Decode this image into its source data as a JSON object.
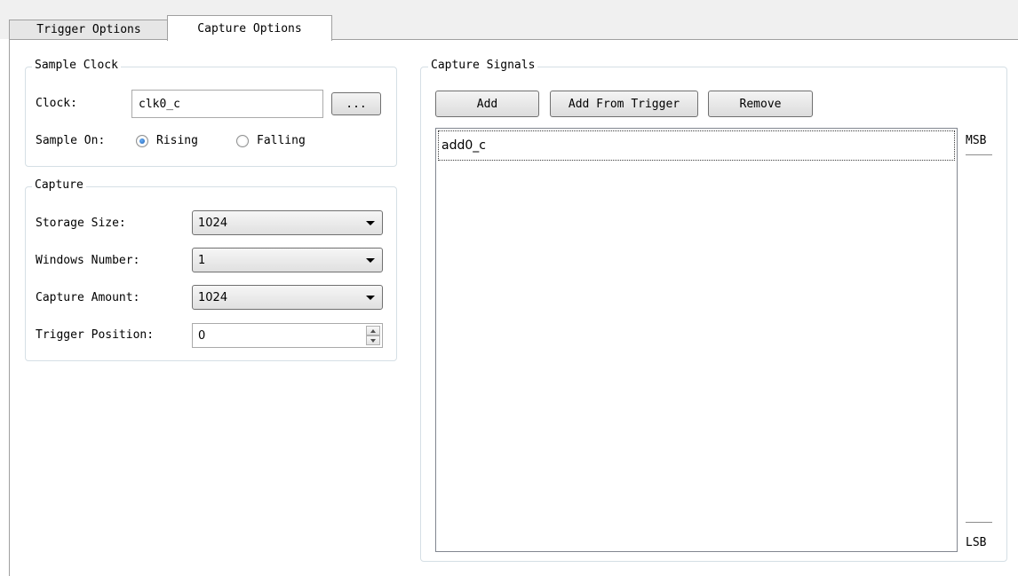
{
  "tabs": [
    {
      "label": "Trigger Options",
      "active": false
    },
    {
      "label": "Capture Options",
      "active": true
    }
  ],
  "sample_clock": {
    "title": "Sample Clock",
    "clock_label": "Clock:",
    "clock_value": "clk0_c",
    "browse_label": "...",
    "sample_on_label": "Sample On:",
    "options": [
      {
        "label": "Rising",
        "selected": true
      },
      {
        "label": "Falling",
        "selected": false
      }
    ]
  },
  "capture": {
    "title": "Capture",
    "fields": [
      {
        "label": "Storage Size:",
        "value": "1024"
      },
      {
        "label": "Windows Number:",
        "value": "1"
      },
      {
        "label": "Capture Amount:",
        "value": "1024"
      }
    ],
    "trigger_position_label": "Trigger Position:",
    "trigger_position_value": "0"
  },
  "capture_signals": {
    "title": "Capture Signals",
    "buttons": {
      "add": "Add",
      "add_from_trigger": "Add From Trigger",
      "remove": "Remove"
    },
    "signals": [
      "add0_c"
    ],
    "msb_label": "MSB",
    "lsb_label": "LSB"
  },
  "colors": {
    "radio_selected": "#1d5fb3",
    "tab_strip_bg": "#f0f0f0",
    "group_border": "#d5dfe5"
  }
}
